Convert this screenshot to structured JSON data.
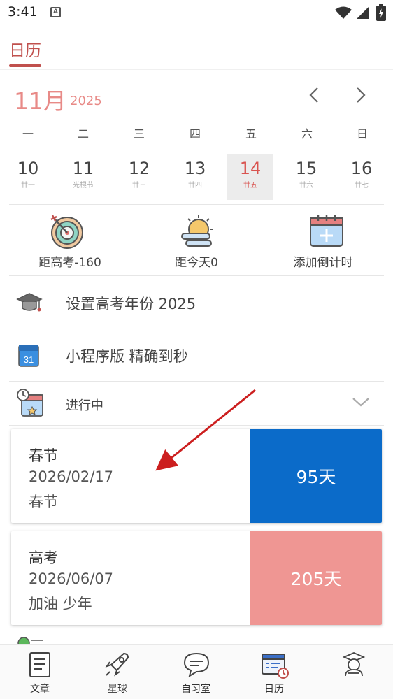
{
  "status": {
    "time": "3:41",
    "notif_letter": "A"
  },
  "tab": {
    "label": "日历"
  },
  "month": {
    "month": "11月",
    "year": "2025"
  },
  "weekdays": [
    "一",
    "二",
    "三",
    "四",
    "五",
    "六",
    "日"
  ],
  "days": [
    {
      "num": "10",
      "sub": "廿一",
      "selected": false
    },
    {
      "num": "11",
      "sub": "光棍节",
      "selected": false
    },
    {
      "num": "12",
      "sub": "廿三",
      "selected": false
    },
    {
      "num": "13",
      "sub": "廿四",
      "selected": false
    },
    {
      "num": "14",
      "sub": "廿五",
      "selected": true
    },
    {
      "num": "15",
      "sub": "廿六",
      "selected": false
    },
    {
      "num": "16",
      "sub": "廿七",
      "selected": false
    }
  ],
  "quick": {
    "gaokao": "距高考-160",
    "today": "距今天0",
    "add": "添加倒计时"
  },
  "rows": {
    "set_year": "设置高考年份  2025",
    "miniprogram": "小程序版 精确到秒",
    "ongoing": "进行中"
  },
  "cards": [
    {
      "title": "春节",
      "date": "2026/02/17",
      "note": "春节",
      "days": "95天",
      "color": "#0b6bc9"
    },
    {
      "title": "高考",
      "date": "2026/06/07",
      "note": "加油 少年",
      "days": "205天",
      "color": "#ef9693"
    }
  ],
  "nav": {
    "article": "文章",
    "planet": "星球",
    "study": "自习室",
    "calendar": "日历"
  },
  "colors": {
    "accent": "#c0504d",
    "month": "#e88a87",
    "arrow": "#cc1f1f"
  }
}
